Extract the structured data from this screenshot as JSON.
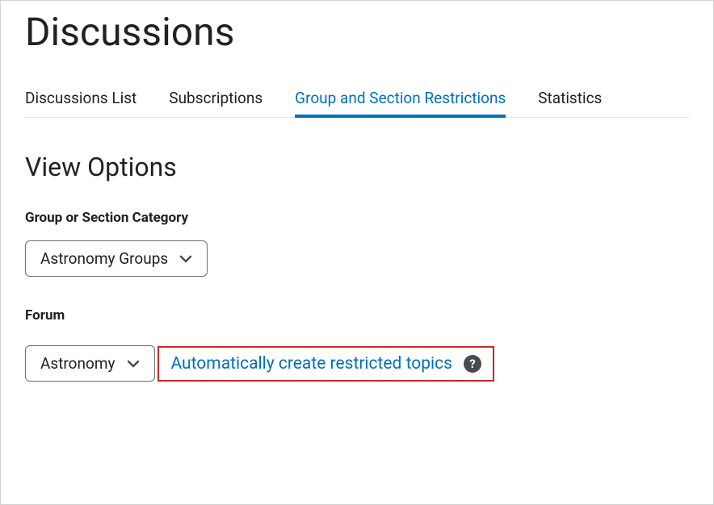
{
  "header": {
    "title": "Discussions"
  },
  "tabs": [
    {
      "label": "Discussions List",
      "active": false
    },
    {
      "label": "Subscriptions",
      "active": false
    },
    {
      "label": "Group and Section Restrictions",
      "active": true
    },
    {
      "label": "Statistics",
      "active": false
    }
  ],
  "view_options": {
    "title": "View Options",
    "category_label": "Group or Section Category",
    "category_value": "Astronomy Groups",
    "forum_label": "Forum",
    "forum_value": "Astronomy"
  },
  "action": {
    "link_label": "Automatically create restricted topics",
    "help_glyph": "?"
  }
}
